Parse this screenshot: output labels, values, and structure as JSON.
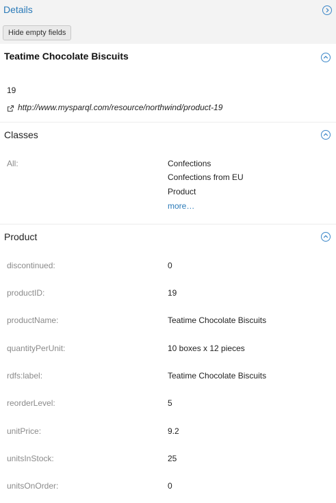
{
  "header": {
    "title": "Details",
    "hide_button_label": "Hide empty fields"
  },
  "resource": {
    "title": "Teatime Chocolate Biscuits",
    "id_value": "19",
    "uri": "http://www.mysparql.com/resource/northwind/product-19"
  },
  "classes": {
    "heading": "Classes",
    "label": "All:",
    "items": [
      "Confections",
      "Confections from EU",
      "Product"
    ],
    "more_label": "more…"
  },
  "product": {
    "heading": "Product",
    "fields": [
      {
        "label": "discontinued:",
        "value": "0"
      },
      {
        "label": "productID:",
        "value": "19"
      },
      {
        "label": "productName:",
        "value": "Teatime Chocolate Biscuits"
      },
      {
        "label": "quantityPerUnit:",
        "value": "10 boxes x 12 pieces"
      },
      {
        "label": "rdfs:label:",
        "value": "Teatime Chocolate Biscuits"
      },
      {
        "label": "reorderLevel:",
        "value": "5"
      },
      {
        "label": "unitPrice:",
        "value": "9.2"
      },
      {
        "label": "unitsInStock:",
        "value": "25"
      },
      {
        "label": "unitsOnOrder:",
        "value": "0"
      }
    ]
  },
  "icons": {
    "expand": "chevron-right-circle-icon",
    "collapse": "chevron-up-circle-icon",
    "external_link": "external-link-icon"
  },
  "colors": {
    "accent": "#2a7ab8",
    "header_bg": "#f3f3f3",
    "label_gray": "#8a8a8a"
  }
}
